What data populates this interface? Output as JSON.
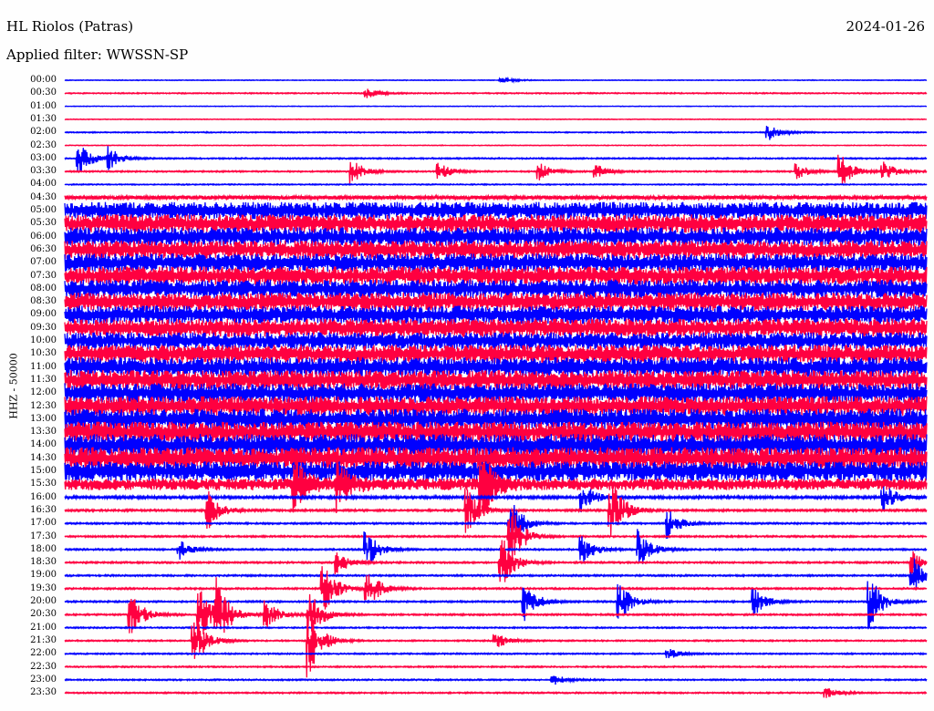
{
  "header": {
    "station": "HL Riolos (Patras)",
    "date": "2024-01-26",
    "filter": "Applied filter: WWSSN-SP"
  },
  "chart_data": {
    "type": "line",
    "title": "HL Riolos (Patras)",
    "ylabel": "HHZ - 50000",
    "minutes_per_row": 30,
    "colors": [
      "#0000ff",
      "#ff0040"
    ],
    "rows": [
      {
        "label": "00:00",
        "noise": 0.05
      },
      {
        "label": "00:30",
        "noise": 0.08
      },
      {
        "label": "01:00",
        "noise": 0.04
      },
      {
        "label": "01:30",
        "noise": 0.05
      },
      {
        "label": "02:00",
        "noise": 0.08
      },
      {
        "label": "02:30",
        "noise": 0.05
      },
      {
        "label": "03:00",
        "noise": 0.1
      },
      {
        "label": "03:30",
        "noise": 0.1
      },
      {
        "label": "04:00",
        "noise": 0.08
      },
      {
        "label": "04:30",
        "noise": 0.3
      },
      {
        "label": "05:00",
        "noise": 1.3
      },
      {
        "label": "05:30",
        "noise": 1.4
      },
      {
        "label": "06:00",
        "noise": 1.4
      },
      {
        "label": "06:30",
        "noise": 1.4
      },
      {
        "label": "07:00",
        "noise": 1.4
      },
      {
        "label": "07:30",
        "noise": 1.4
      },
      {
        "label": "08:00",
        "noise": 1.4
      },
      {
        "label": "08:30",
        "noise": 1.4
      },
      {
        "label": "09:00",
        "noise": 1.4
      },
      {
        "label": "09:30",
        "noise": 1.4
      },
      {
        "label": "10:00",
        "noise": 1.3
      },
      {
        "label": "10:30",
        "noise": 1.4
      },
      {
        "label": "11:00",
        "noise": 1.5
      },
      {
        "label": "11:30",
        "noise": 1.5
      },
      {
        "label": "12:00",
        "noise": 1.5
      },
      {
        "label": "12:30",
        "noise": 1.5
      },
      {
        "label": "13:00",
        "noise": 1.6
      },
      {
        "label": "13:30",
        "noise": 1.6
      },
      {
        "label": "14:00",
        "noise": 1.7
      },
      {
        "label": "14:30",
        "noise": 1.7
      },
      {
        "label": "15:00",
        "noise": 1.5
      },
      {
        "label": "15:30",
        "noise": 0.9
      },
      {
        "label": "16:00",
        "noise": 0.2
      },
      {
        "label": "16:30",
        "noise": 0.15
      },
      {
        "label": "17:00",
        "noise": 0.12
      },
      {
        "label": "17:30",
        "noise": 0.12
      },
      {
        "label": "18:00",
        "noise": 0.12
      },
      {
        "label": "18:30",
        "noise": 0.12
      },
      {
        "label": "19:00",
        "noise": 0.12
      },
      {
        "label": "19:30",
        "noise": 0.12
      },
      {
        "label": "20:00",
        "noise": 0.12
      },
      {
        "label": "20:30",
        "noise": 0.12
      },
      {
        "label": "21:00",
        "noise": 0.1
      },
      {
        "label": "21:30",
        "noise": 0.1
      },
      {
        "label": "22:00",
        "noise": 0.1
      },
      {
        "label": "22:30",
        "noise": 0.1
      },
      {
        "label": "23:00",
        "noise": 0.1
      },
      {
        "label": "23:30",
        "noise": 0.1
      }
    ],
    "events": [
      {
        "row": 0,
        "minute": 15.2,
        "amp": 2
      },
      {
        "row": 1,
        "minute": 10.5,
        "amp": 3
      },
      {
        "row": 4,
        "minute": 24.5,
        "amp": 4
      },
      {
        "row": 6,
        "minute": 0.5,
        "amp": 8
      },
      {
        "row": 6,
        "minute": 1.5,
        "amp": 6
      },
      {
        "row": 7,
        "minute": 10,
        "amp": 6
      },
      {
        "row": 7,
        "minute": 13,
        "amp": 5
      },
      {
        "row": 7,
        "minute": 16.5,
        "amp": 5
      },
      {
        "row": 7,
        "minute": 18.5,
        "amp": 4
      },
      {
        "row": 7,
        "minute": 25.5,
        "amp": 4
      },
      {
        "row": 7,
        "minute": 27,
        "amp": 9
      },
      {
        "row": 7,
        "minute": 28.5,
        "amp": 5
      },
      {
        "row": 31,
        "minute": 8,
        "amp": 14
      },
      {
        "row": 31,
        "minute": 9.5,
        "amp": 12
      },
      {
        "row": 31,
        "minute": 14.5,
        "amp": 20
      },
      {
        "row": 32,
        "minute": 18,
        "amp": 8
      },
      {
        "row": 32,
        "minute": 28.5,
        "amp": 8
      },
      {
        "row": 33,
        "minute": 5,
        "amp": 10
      },
      {
        "row": 33,
        "minute": 14,
        "amp": 12
      },
      {
        "row": 33,
        "minute": 19,
        "amp": 18
      },
      {
        "row": 34,
        "minute": 15.5,
        "amp": 14
      },
      {
        "row": 34,
        "minute": 21,
        "amp": 8
      },
      {
        "row": 35,
        "minute": 15.5,
        "amp": 18
      },
      {
        "row": 36,
        "minute": 4,
        "amp": 5
      },
      {
        "row": 36,
        "minute": 10.5,
        "amp": 10
      },
      {
        "row": 36,
        "minute": 18,
        "amp": 8
      },
      {
        "row": 36,
        "minute": 20,
        "amp": 10
      },
      {
        "row": 37,
        "minute": 9.5,
        "amp": 6
      },
      {
        "row": 37,
        "minute": 15.2,
        "amp": 14
      },
      {
        "row": 37,
        "minute": 29.5,
        "amp": 6
      },
      {
        "row": 38,
        "minute": 29.5,
        "amp": 10
      },
      {
        "row": 39,
        "minute": 9,
        "amp": 14
      },
      {
        "row": 39,
        "minute": 10.5,
        "amp": 12
      },
      {
        "row": 40,
        "minute": 16,
        "amp": 10
      },
      {
        "row": 40,
        "minute": 19.3,
        "amp": 10
      },
      {
        "row": 40,
        "minute": 24,
        "amp": 7
      },
      {
        "row": 40,
        "minute": 28,
        "amp": 14
      },
      {
        "row": 41,
        "minute": 2.3,
        "amp": 12
      },
      {
        "row": 41,
        "minute": 4.7,
        "amp": 14
      },
      {
        "row": 41,
        "minute": 5.3,
        "amp": 16
      },
      {
        "row": 41,
        "minute": 7,
        "amp": 8
      },
      {
        "row": 41,
        "minute": 8.5,
        "amp": 14
      },
      {
        "row": 43,
        "minute": 4.5,
        "amp": 14
      },
      {
        "row": 43,
        "minute": 8.5,
        "amp": 18
      },
      {
        "row": 43,
        "minute": 15,
        "amp": 4
      },
      {
        "row": 44,
        "minute": 21,
        "amp": 3
      },
      {
        "row": 46,
        "minute": 17,
        "amp": 3
      },
      {
        "row": 47,
        "minute": 26.5,
        "amp": 3
      }
    ]
  }
}
